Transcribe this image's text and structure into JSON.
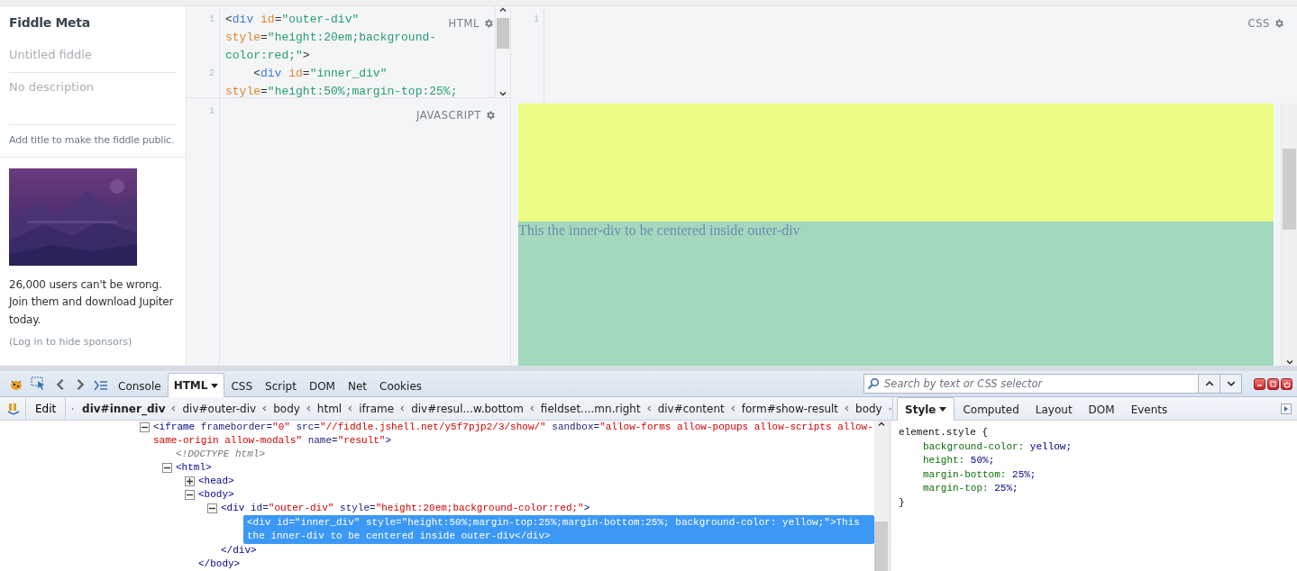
{
  "sidebar": {
    "title": "Fiddle Meta",
    "title_field": {
      "placeholder": "Untitled fiddle"
    },
    "description_field": {
      "placeholder": "No description"
    },
    "hint": "Add title to make the fiddle public.",
    "sponsor": {
      "text": "26,000 users can't be wrong. Join them and download Jupiter today.",
      "link": "(Log in to hide sponsors)"
    }
  },
  "editors": [
    {
      "label": "HTML",
      "lines": [
        {
          "number": "1",
          "rows": [
            {
              "segments": [
                {
                  "kind": "punct",
                  "text": "<"
                },
                {
                  "kind": "tag",
                  "text": "div"
                },
                {
                  "kind": "attr",
                  "text": " id"
                },
                {
                  "kind": "punct",
                  "text": "="
                },
                {
                  "kind": "string",
                  "text": "\"outer-div\""
                }
              ]
            },
            {
              "segments": [
                {
                  "kind": "attr",
                  "text": "style"
                },
                {
                  "kind": "punct",
                  "text": "="
                },
                {
                  "kind": "string",
                  "text": "\"height:20em;background-"
                }
              ]
            },
            {
              "segments": [
                {
                  "kind": "string",
                  "text": "color:red;\""
                },
                {
                  "kind": "punct",
                  "text": ">"
                }
              ]
            }
          ]
        },
        {
          "number": "2",
          "rows": [
            {
              "segments": [
                {
                  "kind": "punct",
                  "text": "    <"
                },
                {
                  "kind": "tag",
                  "text": "div"
                },
                {
                  "kind": "attr",
                  "text": " id"
                },
                {
                  "kind": "punct",
                  "text": "="
                },
                {
                  "kind": "string",
                  "text": "\"inner_div\""
                }
              ]
            },
            {
              "segments": [
                {
                  "kind": "attr",
                  "text": "style"
                },
                {
                  "kind": "punct",
                  "text": "="
                },
                {
                  "kind": "string",
                  "text": "\"height:50%;margin-top:25%;"
                }
              ]
            }
          ]
        }
      ]
    },
    {
      "label": "JAVASCRIPT",
      "lines": [
        {
          "number": "1"
        }
      ]
    },
    {
      "label": "CSS",
      "lines": [
        {
          "number": "1"
        }
      ]
    }
  ],
  "result": {
    "text": "This the inner-div to be centered inside outer-div"
  },
  "devtools": {
    "tabs": [
      {
        "label": "Console",
        "selected": false,
        "has_menu": false
      },
      {
        "label": "HTML",
        "selected": true,
        "has_menu": true
      },
      {
        "label": "CSS",
        "selected": false,
        "has_menu": false
      },
      {
        "label": "Script",
        "selected": false,
        "has_menu": false
      },
      {
        "label": "DOM",
        "selected": false,
        "has_menu": false
      },
      {
        "label": "Net",
        "selected": false,
        "has_menu": false
      },
      {
        "label": "Cookies",
        "selected": false,
        "has_menu": false
      }
    ],
    "search": {
      "placeholder": "Search by text or CSS selector"
    },
    "edit_label": "Edit",
    "breadcrumb": [
      {
        "label": "div#inner_div",
        "selected": true
      },
      {
        "label": "div#outer-div",
        "selected": false
      },
      {
        "label": "body",
        "selected": false
      },
      {
        "label": "html",
        "selected": false
      },
      {
        "label": "iframe",
        "selected": false
      },
      {
        "label": "div#resul...w.bottom",
        "selected": false
      },
      {
        "label": "fieldset....mn.right",
        "selected": false
      },
      {
        "label": "div#content",
        "selected": false
      },
      {
        "label": "form#show-result",
        "selected": false
      },
      {
        "label": "body",
        "selected": false
      }
    ],
    "tree": [
      {
        "expanded": true,
        "selected": false,
        "tokens": [
          {
            "kind": "tag",
            "text": "<iframe"
          },
          {
            "kind": "attr",
            "text": " frameborder="
          },
          {
            "kind": "value",
            "text": "\"0\""
          },
          {
            "kind": "attr",
            "text": " src="
          },
          {
            "kind": "value",
            "text": "\"//fiddle.jshell.net/y5f7pjp2/3/show/\""
          },
          {
            "kind": "attr",
            "text": " sandbox="
          },
          {
            "kind": "value",
            "text": "\"allow-forms allow-popups allow-scripts allow-same-origin allow-modals\""
          },
          {
            "kind": "attr",
            "text": " name="
          },
          {
            "kind": "value",
            "text": "\"result\""
          },
          {
            "kind": "tag",
            "text": ">"
          }
        ],
        "children": [
          {
            "selected": false,
            "tokens": [
              {
                "kind": "comment",
                "text": "<!DOCTYPE html>"
              }
            ]
          },
          {
            "expanded": true,
            "selected": false,
            "tokens": [
              {
                "kind": "tag",
                "text": "<html>"
              }
            ],
            "children": [
              {
                "expanded": false,
                "selected": false,
                "tokens": [
                  {
                    "kind": "tag",
                    "text": "<head>"
                  }
                ]
              },
              {
                "expanded": true,
                "selected": false,
                "tokens": [
                  {
                    "kind": "tag",
                    "text": "<body>"
                  }
                ],
                "closing": "</body>",
                "children": [
                  {
                    "expanded": true,
                    "selected": false,
                    "tokens": [
                      {
                        "kind": "tag",
                        "text": "<div"
                      },
                      {
                        "kind": "attr",
                        "text": " id="
                      },
                      {
                        "kind": "value",
                        "text": "\"outer-div\""
                      },
                      {
                        "kind": "attr",
                        "text": " style="
                      },
                      {
                        "kind": "value",
                        "text": "\"height:20em;background-color:red;\""
                      },
                      {
                        "kind": "tag",
                        "text": ">"
                      }
                    ],
                    "closing": "</div>",
                    "children": [
                      {
                        "selected": true,
                        "tokens": [
                          {
                            "kind": "text",
                            "text": "<div id=\"inner_div\" style=\"height:50%;margin-top:25%;margin-bottom:25%; background-color: yellow;\">This the inner-div to be centered inside outer-div</div>"
                          }
                        ]
                      }
                    ]
                  }
                ]
              }
            ]
          }
        ]
      }
    ],
    "side_tabs": [
      {
        "label": "Style",
        "selected": true,
        "has_menu": true
      },
      {
        "label": "Computed",
        "selected": false,
        "has_menu": false
      },
      {
        "label": "Layout",
        "selected": false,
        "has_menu": false
      },
      {
        "label": "DOM",
        "selected": false,
        "has_menu": false
      },
      {
        "label": "Events",
        "selected": false,
        "has_menu": false
      }
    ],
    "style_rule": {
      "selector": "element.style {",
      "properties": [
        {
          "name": "background-color:",
          "value": "yellow;"
        },
        {
          "name": "height:",
          "value": "50%;"
        },
        {
          "name": "margin-bottom:",
          "value": "25%;"
        },
        {
          "name": "margin-top:",
          "value": "25%;"
        }
      ],
      "close": "}"
    }
  }
}
